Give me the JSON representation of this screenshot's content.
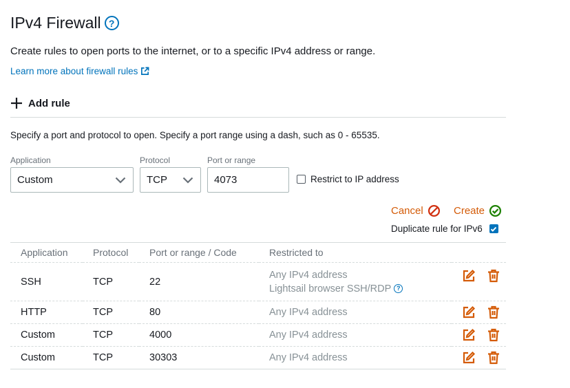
{
  "header": {
    "title": "IPv4 Firewall",
    "help_glyph": "?",
    "description": "Create rules to open ports to the internet, or to a specific IPv4 address or range.",
    "learn_more": "Learn more about firewall rules"
  },
  "add_rule": {
    "label": "Add rule"
  },
  "form": {
    "instructions": "Specify a port and protocol to open. Specify a port range using a dash, such as 0 - 65535.",
    "application_label": "Application",
    "application_value": "Custom",
    "protocol_label": "Protocol",
    "protocol_value": "TCP",
    "port_label": "Port or range",
    "port_value": "4073",
    "restrict_label": "Restrict to IP address",
    "cancel": "Cancel",
    "create": "Create",
    "duplicate_label": "Duplicate rule for IPv6"
  },
  "table": {
    "headers": [
      "Application",
      "Protocol",
      "Port or range / Code",
      "Restricted to"
    ],
    "rows": [
      {
        "application": "SSH",
        "protocol": "TCP",
        "port": "22",
        "restricted": "Any IPv4 address",
        "restricted_extra": "Lightsail browser SSH/RDP"
      },
      {
        "application": "HTTP",
        "protocol": "TCP",
        "port": "80",
        "restricted": "Any IPv4 address"
      },
      {
        "application": "Custom",
        "protocol": "TCP",
        "port": "4000",
        "restricted": "Any IPv4 address"
      },
      {
        "application": "Custom",
        "protocol": "TCP",
        "port": "30303",
        "restricted": "Any IPv4 address"
      }
    ]
  },
  "colors": {
    "link": "#0073bb",
    "action_orange": "#d45b07",
    "cancel_red": "#d13212",
    "create_green": "#1d8102",
    "muted_text": "#879196"
  },
  "icons": [
    "help-icon",
    "external-link-icon",
    "plus-icon",
    "chevron-down-icon",
    "cancel-icon",
    "check-circle-icon",
    "edit-icon",
    "delete-icon"
  ]
}
